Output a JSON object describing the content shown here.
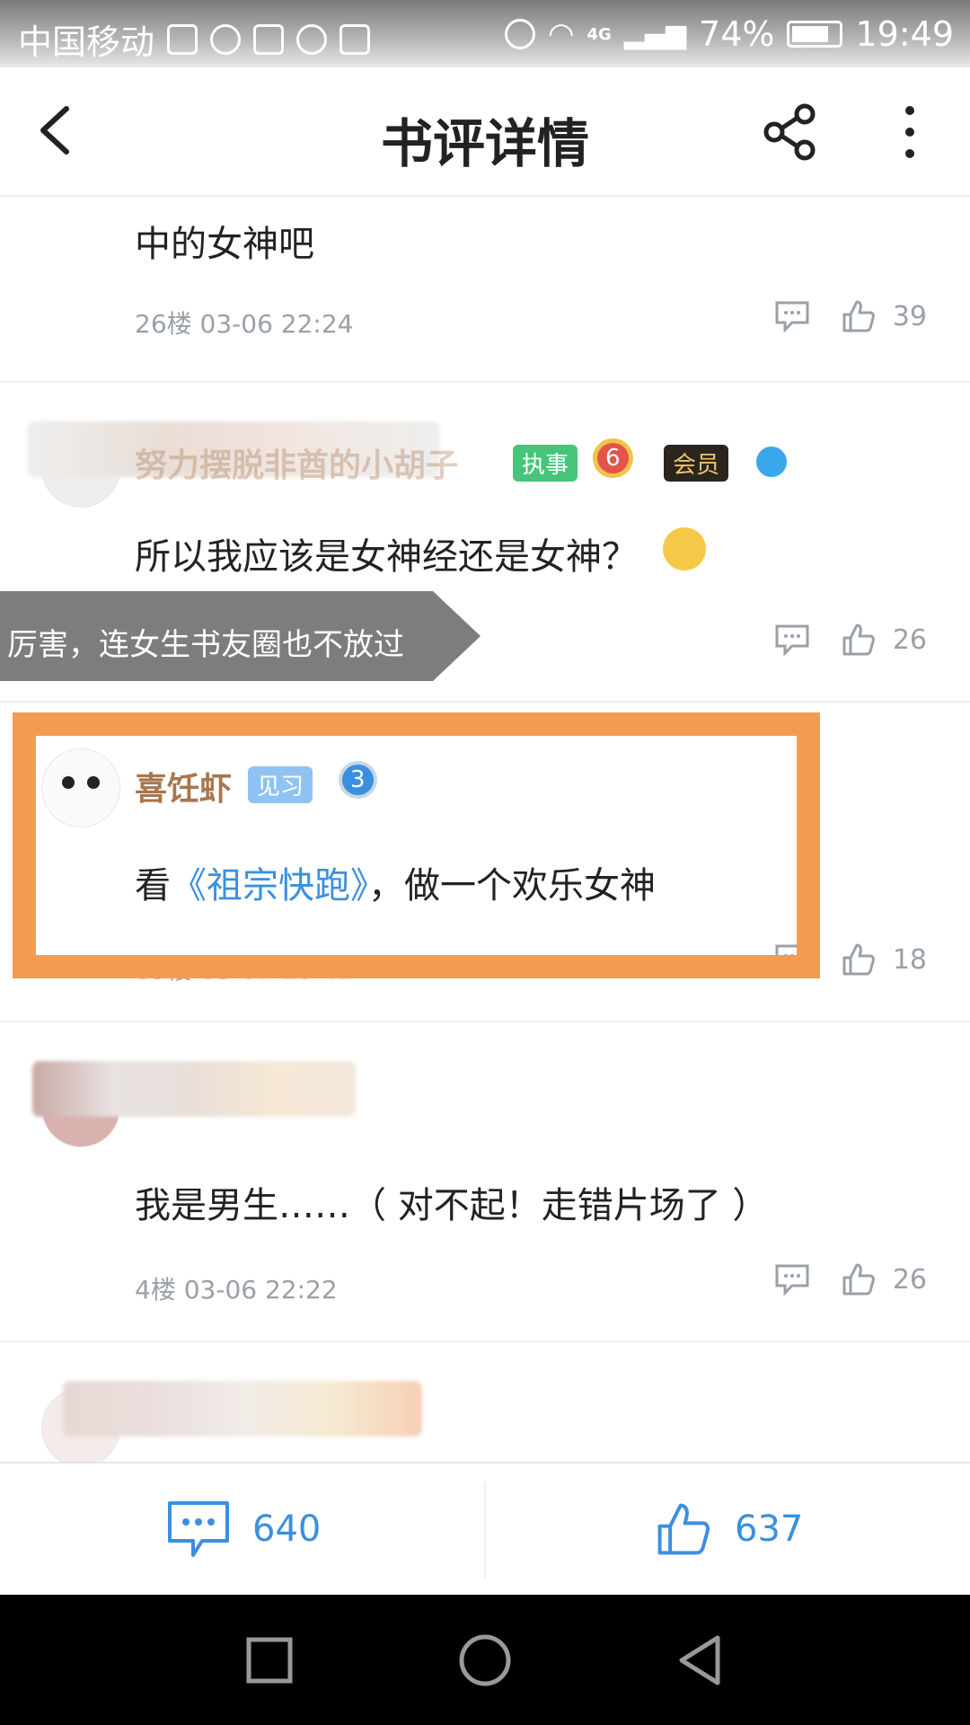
{
  "status_bar": {
    "carrier": "中国移动",
    "network": "4G",
    "battery": "74%",
    "time": "19:49"
  },
  "header": {
    "title": "书评详情"
  },
  "posts": [
    {
      "text": "中的女神吧",
      "floor_time": "26楼 03-06 22:24",
      "likes": "39"
    },
    {
      "username_fragment": "努力摆脱非酋的小胡子",
      "badge_role": "执事",
      "badge_level": "6",
      "badge_member": "会员",
      "text": "所以我应该是女神经还是女神？",
      "likes": "26"
    },
    {
      "username": "喜饪虾",
      "badge_trainee": "见习",
      "badge_level": "3",
      "text_prefix": "看",
      "book_link": "《祖宗快跑》",
      "text_suffix": "，做一个欢乐女神",
      "floor_time": "83楼 03-07 10:41",
      "likes": "18"
    },
    {
      "text": "我是男生……（ 对不起！走错片场了 ）",
      "floor_time": "4楼 03-06 22:22",
      "likes": "26"
    }
  ],
  "tooltip": {
    "text": "厉害，连女生书友圈也不放过"
  },
  "bottom_bar": {
    "comments": "640",
    "likes": "637"
  },
  "colors": {
    "accent": "#3b8fe0",
    "highlight": "#f39c4f",
    "username": "#a7764f"
  }
}
